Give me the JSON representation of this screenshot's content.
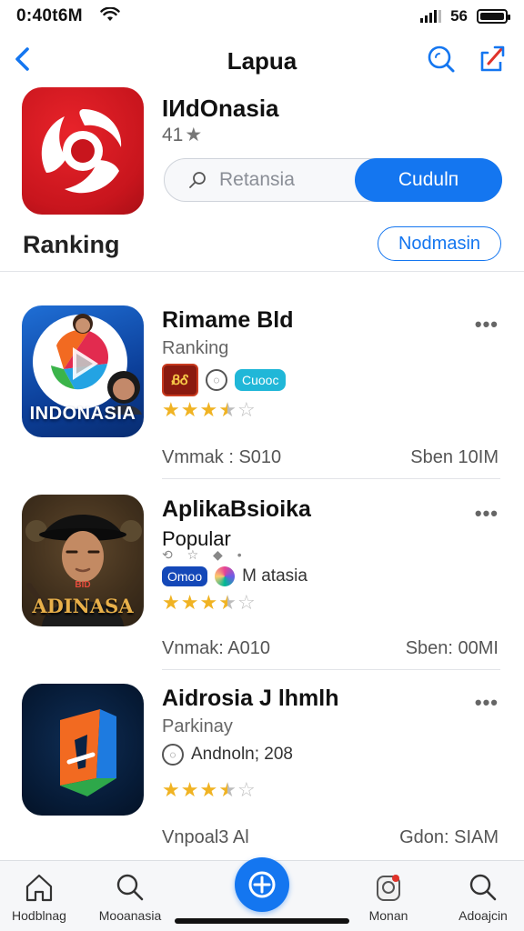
{
  "status": {
    "time": "0:40t6M",
    "network": "56"
  },
  "nav": {
    "title": "Lapua"
  },
  "hero": {
    "name": "IИdOnasia",
    "rating": "41",
    "search_placeholder": "Retansia",
    "primary_button": "Cudulп"
  },
  "section": {
    "title": "Ranking",
    "button": "Nodmasin"
  },
  "rows": [
    {
      "name": "Rimame Bld",
      "subtitle": "Ranking",
      "thumb_caption": "INDONASIA",
      "chip_box": "ᏰᎴ",
      "chip_pill": "Cuooc",
      "stars": 3.5,
      "foot_left": "Vmmak : S010",
      "foot_right": "Sben 10IM"
    },
    {
      "name": "AplikaBsioika",
      "subtitle": "Popular",
      "thumb_caption": "ADINASA",
      "thumb_small": "BID",
      "chip_dark": "Omoo",
      "chip_text": "M atasia",
      "stars": 3.5,
      "foot_left": "Vnmak: A010",
      "foot_right": "Sben: 00MI"
    },
    {
      "name": "Aidrosia J lhmlh",
      "subtitle": "Parkinay",
      "chip_text": "Andnoln; 208",
      "stars": 3.5,
      "foot_left": "Vnpoal3 Al",
      "foot_right": "Gdon: SIAM"
    }
  ],
  "tabs": [
    {
      "label": "Hodblnag"
    },
    {
      "label": "Mooanasia"
    },
    {
      "label": "Monan"
    },
    {
      "label": "Adoajcin"
    }
  ],
  "colors": {
    "accent": "#1476f0",
    "hero_red": "#c8151d",
    "star": "#f0b323"
  }
}
